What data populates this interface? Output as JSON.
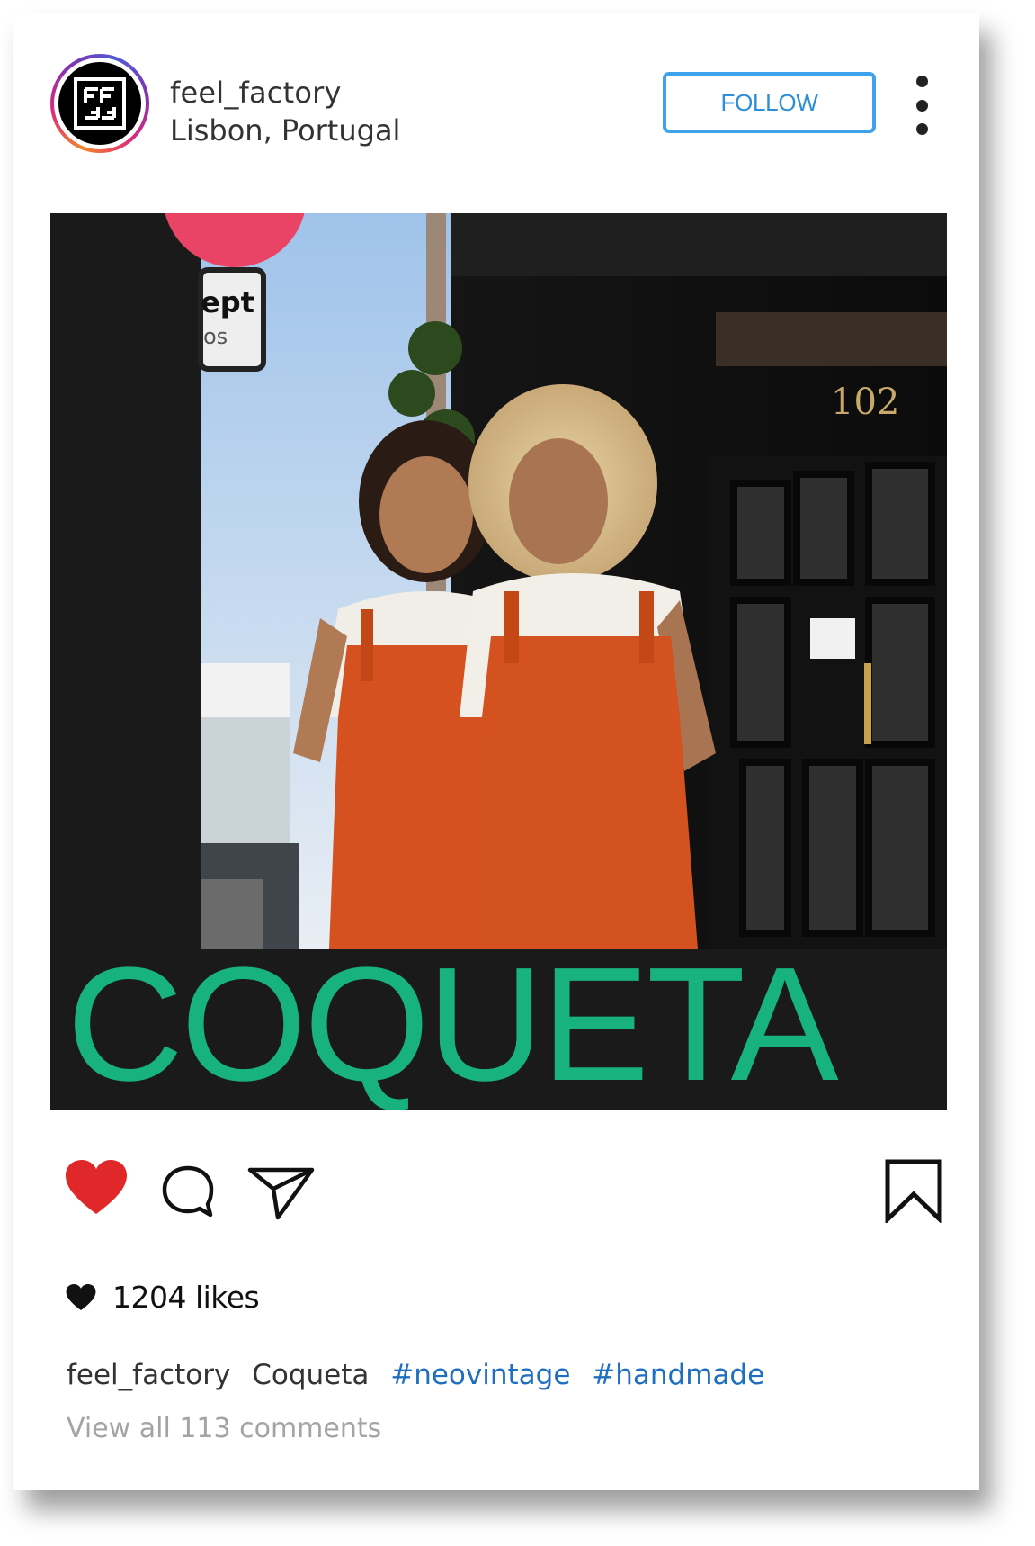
{
  "post": {
    "username": "feel_factory",
    "location": "Lisbon, Portugal",
    "follow_label": "FOLLOW",
    "avatar_icon": "ff-logo-icon",
    "menu_icon": "more-vertical-icon",
    "image": {
      "title": "COQUETA",
      "title_color": "#17b27d",
      "background_color": "#1a1a1a",
      "sign_text": "ept",
      "sign_subtext": "os",
      "house_number": "102"
    },
    "actions": {
      "like_icon": "heart-filled-icon",
      "like_color": "#e0282a",
      "comment_icon": "comment-bubble-icon",
      "share_icon": "send-paper-plane-icon",
      "save_icon": "bookmark-icon"
    },
    "likes_text": "1204 likes",
    "caption": {
      "username": "feel_factory",
      "text": "Coqueta",
      "hashtags": [
        "#neovintage",
        "#handmade"
      ]
    },
    "comments_link": "View all 113 comments"
  },
  "colors": {
    "follow_border": "#3ea3ec",
    "hashtag": "#1f6fc0",
    "muted_text": "#a4a4a4"
  }
}
